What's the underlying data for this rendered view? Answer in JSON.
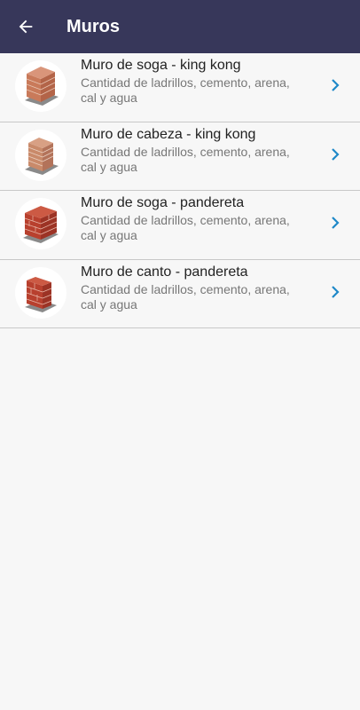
{
  "appbar": {
    "title": "Muros",
    "back_icon": "arrow-left-icon",
    "background": "#37375a"
  },
  "items": [
    {
      "name": "Muro de soga - king kong",
      "desc": "Cantidad de ladrillos, cemento, arena, cal y agua",
      "icon": "brick-wall-icon",
      "brick_color": "#c97a5a"
    },
    {
      "name": "Muro de cabeza - king kong",
      "desc": "Cantidad de ladrillos, cemento, arena, cal y agua",
      "icon": "brick-wall-icon",
      "brick_color": "#c98a6a"
    },
    {
      "name": "Muro de soga - pandereta",
      "desc": "Cantidad de ladrillos, cemento, arena, cal y agua",
      "icon": "brick-wall-icon",
      "brick_color": "#b8402e"
    },
    {
      "name": "Muro de canto - pandereta",
      "desc": "Cantidad de ladrillos, cemento, arena, cal y agua",
      "icon": "brick-wall-icon",
      "brick_color": "#b8402e"
    }
  ],
  "accent_color": "#1e88c8"
}
